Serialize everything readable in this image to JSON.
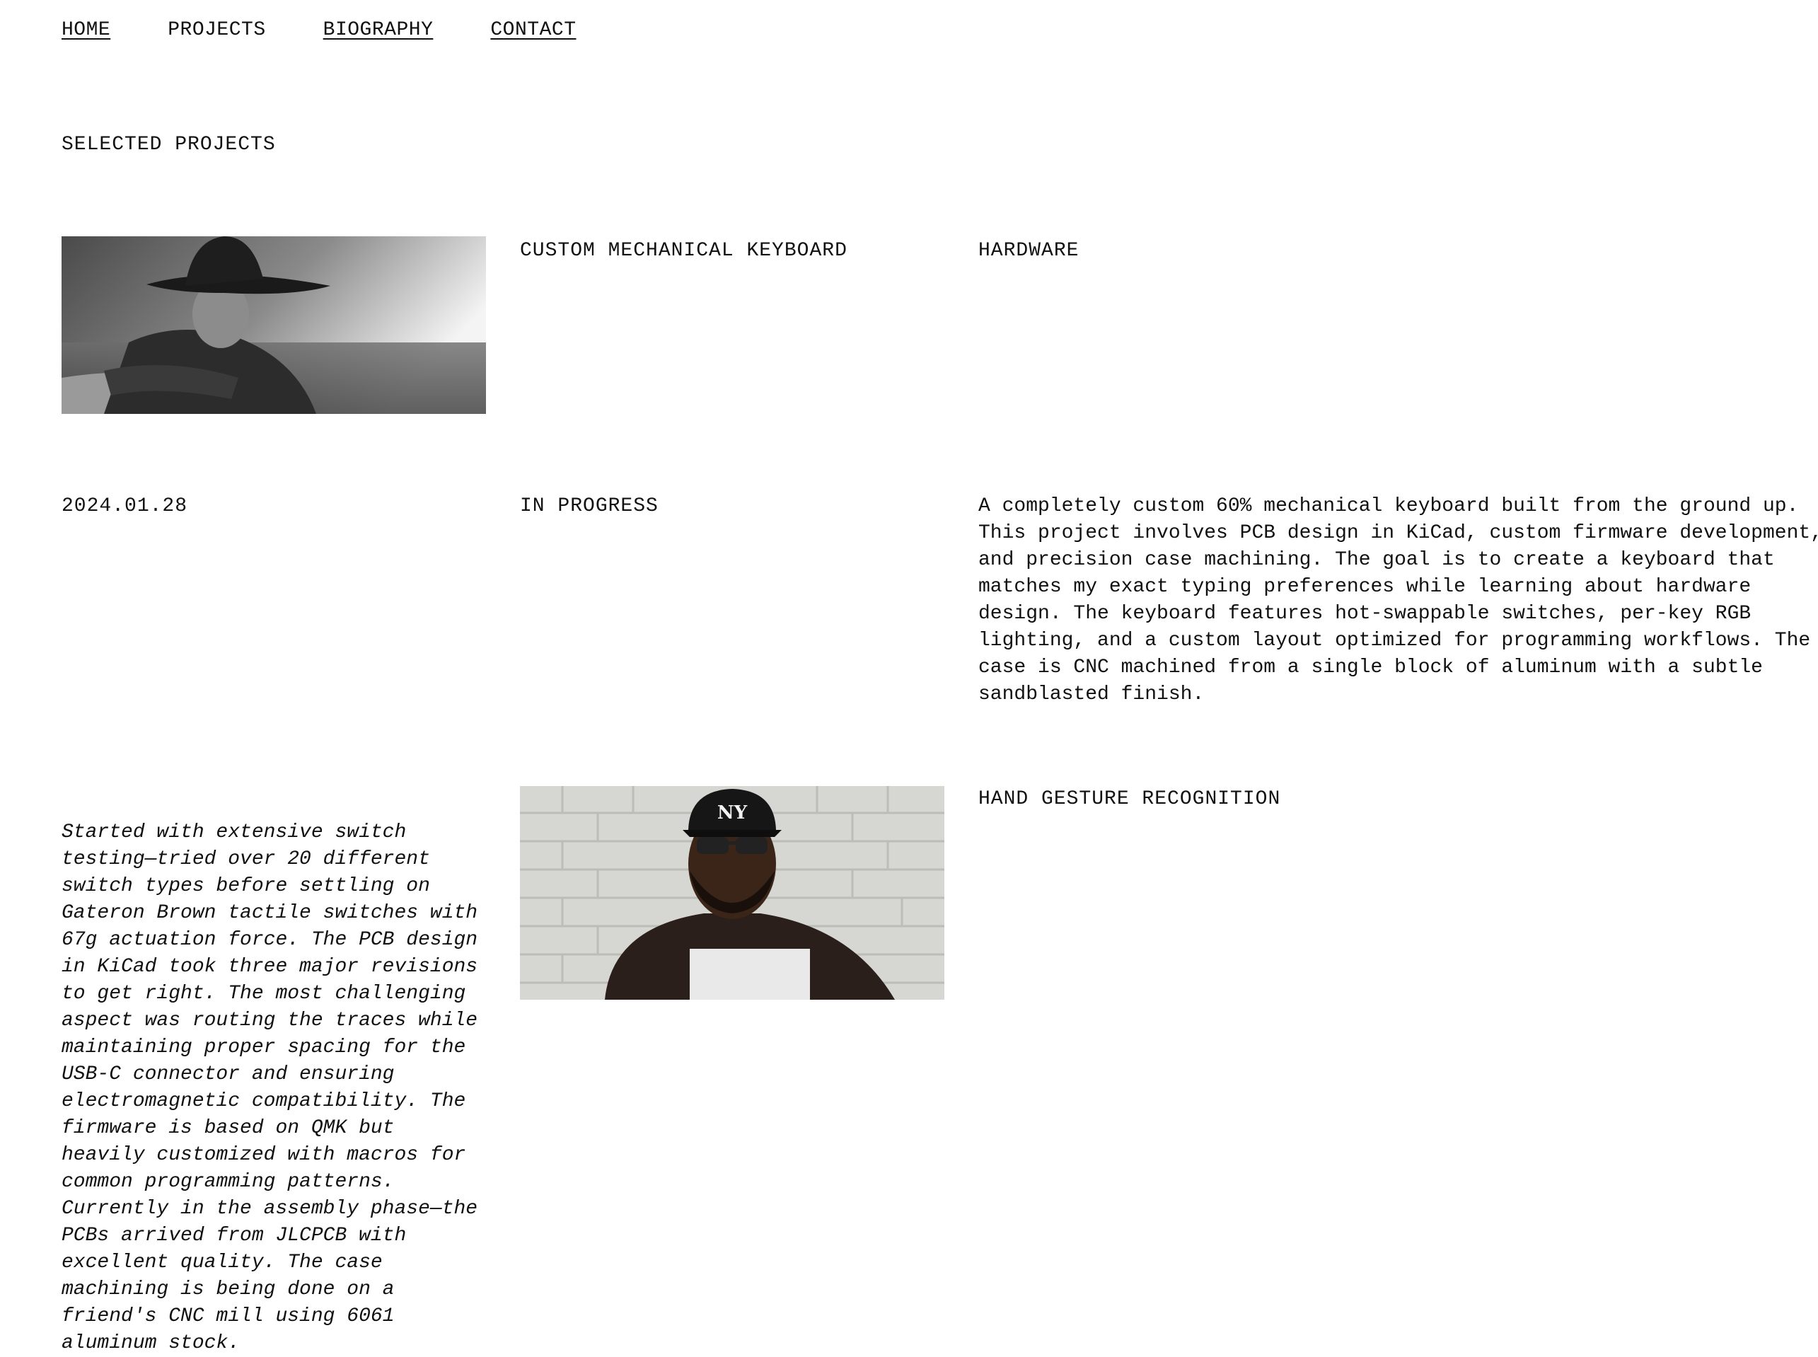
{
  "nav": {
    "items": [
      {
        "label": "HOME",
        "underlined": true
      },
      {
        "label": "PROJECTS",
        "underlined": false
      },
      {
        "label": "BIOGRAPHY",
        "underlined": true
      },
      {
        "label": "CONTACT",
        "underlined": true
      }
    ]
  },
  "section": {
    "title": "SELECTED PROJECTS"
  },
  "projects": [
    {
      "title": "CUSTOM MECHANICAL KEYBOARD",
      "category": "HARDWARE",
      "date": "2024.01.28",
      "status": "IN PROGRESS",
      "description": "A completely custom 60% mechanical keyboard built from the ground up. This project involves PCB design in KiCad, custom firmware development, and precision case machining. The goal is to create a keyboard that matches my exact typing preferences while learning about hardware design. The keyboard features hot-swappable switches, per-key RGB lighting, and a custom layout optimized for programming workflows. The case is CNC machined from a single block of aluminum with a subtle sandblasted finish.",
      "notes": "Started with extensive switch testing—tried over 20 different switch types before settling on Gateron Brown tactile switches with 67g actuation force. The PCB design in KiCad took three major revisions to get right. The most challenging aspect was routing the traces while maintaining proper spacing for the USB-C connector and ensuring electromagnetic compatibility. The firmware is based on QMK but heavily customized with macros for common programming patterns. Currently in the assembly phase—the PCBs arrived from JLCPCB with excellent quality. The case machining is being done on a friend's CNC mill using 6061 aluminum stock.",
      "image_icon": "cowboy-portrait-photo"
    },
    {
      "title": "HAND GESTURE RECOGNITION",
      "image_icon": "man-in-cap-photo",
      "image_text": "NY"
    }
  ],
  "colors": {
    "text": "#111111",
    "background": "#ffffff"
  }
}
